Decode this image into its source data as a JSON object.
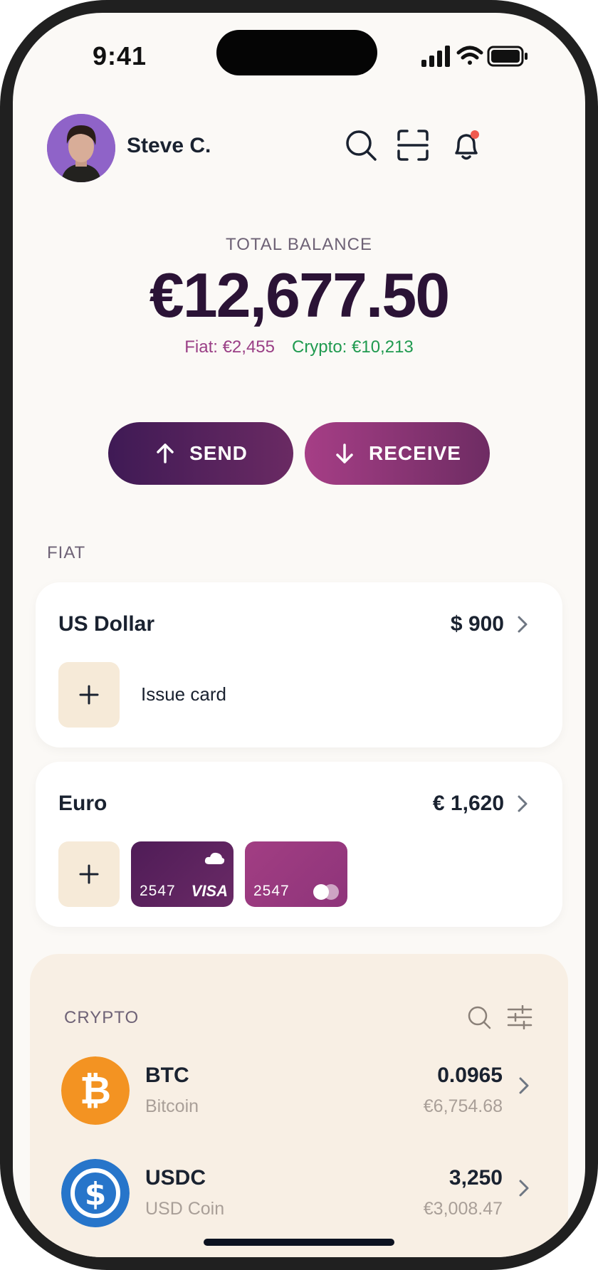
{
  "status_bar": {
    "time": "9:41"
  },
  "header": {
    "username": "Steve C."
  },
  "balance": {
    "label": "TOTAL BALANCE",
    "amount": "€12,677.50",
    "fiat": "Fiat: €2,455",
    "crypto": "Crypto: €10,213"
  },
  "actions": {
    "send_label": "SEND",
    "receive_label": "RECEIVE"
  },
  "fiat": {
    "section_label": "FIAT",
    "accounts": [
      {
        "currency": "US Dollar",
        "amount": "$ 900",
        "issue_label": "Issue card"
      },
      {
        "currency": "Euro",
        "amount": "€ 1,620",
        "cards": [
          {
            "last4": "2547",
            "network": "VISA"
          },
          {
            "last4": "2547",
            "network": "mastercard"
          }
        ]
      }
    ]
  },
  "crypto": {
    "section_label": "CRYPTO",
    "coins": [
      {
        "symbol": "BTC",
        "name": "Bitcoin",
        "quantity": "0.0965",
        "value": "€6,754.68"
      },
      {
        "symbol": "USDC",
        "name": "USD Coin",
        "quantity": "3,250",
        "value": "€3,008.47"
      }
    ]
  },
  "colors": {
    "send_start": "#3f1a55",
    "receive_start": "#a63e86",
    "fiat_sub": "#9a3f86",
    "crypto_sub": "#1f9a4f",
    "btc": "#f39322",
    "usdc": "#2775ca"
  }
}
